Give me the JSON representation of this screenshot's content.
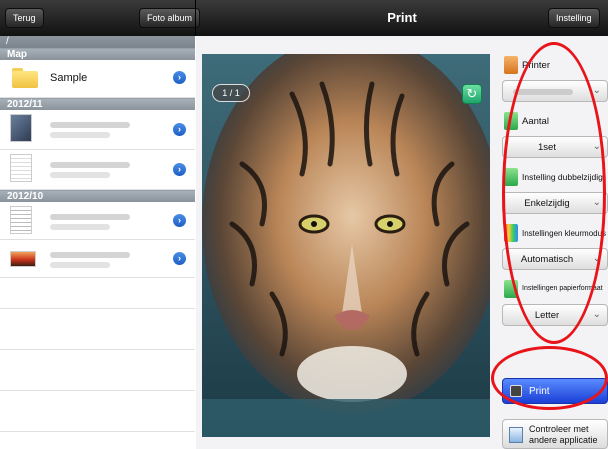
{
  "topbar": {
    "back_label": "Terug",
    "album_label": "Foto album",
    "title": "Print",
    "settings_label": "Instelling"
  },
  "left": {
    "path": "/",
    "folder_section": "Map",
    "folders": [
      {
        "name": "Sample"
      }
    ],
    "groups": [
      {
        "label": "2012/11",
        "files": 2
      },
      {
        "label": "2012/10",
        "files": 2
      }
    ]
  },
  "preview": {
    "page_indicator": "1 / 1",
    "image_icon": "tiger-photo"
  },
  "settings": {
    "printer_label": "Printer",
    "printer_value": "",
    "copies_label": "Aantal",
    "copies_value": "1set",
    "duplex_label": "Instelling dubbelzijdig",
    "duplex_value": "Enkelzijdig",
    "color_label": "Instellingen kleurmodus",
    "color_value": "Automatisch",
    "paper_label": "Instellingen papierformaat",
    "paper_value": "Letter",
    "print_button": "Print",
    "check_button_line1": "Controleer met",
    "check_button_line2": "andere applicatie"
  },
  "colors": {
    "accent_blue": "#1a3fd6",
    "highlight_red": "#e8141a",
    "bar_dark": "#1a1a1a"
  }
}
